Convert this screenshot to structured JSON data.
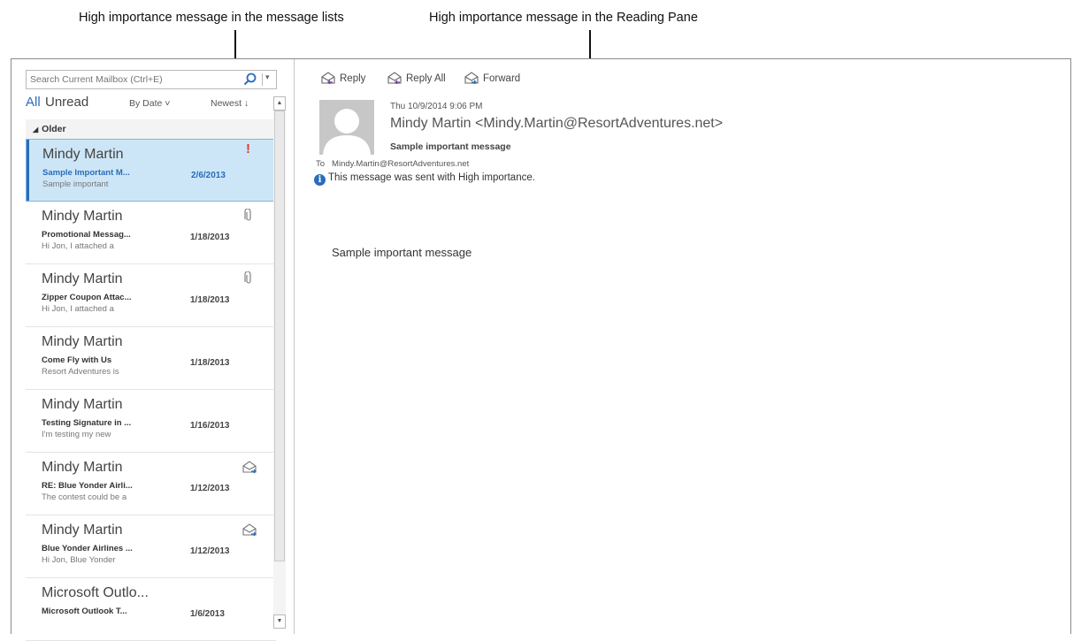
{
  "callouts": {
    "left": "High importance message in the message lists",
    "right": "High importance message in the Reading Pane"
  },
  "search": {
    "placeholder": "Search Current Mailbox (Ctrl+E)"
  },
  "filters": {
    "all": "All",
    "unread": "Unread",
    "sort": "By Date ˅",
    "order": "Newest ↓"
  },
  "group": {
    "label": "Older"
  },
  "messages": [
    {
      "sender": "Mindy Martin",
      "subject": "Sample Important M...",
      "preview": "Sample important",
      "date": "2/6/2013",
      "flag": "!",
      "selected": true
    },
    {
      "sender": "Mindy Martin",
      "subject": "Promotional Messag...",
      "preview": "Hi Jon,  I attached a",
      "date": "1/18/2013",
      "icon": "paperclip-icon"
    },
    {
      "sender": "Mindy Martin",
      "subject": "Zipper Coupon Attac...",
      "preview": "Hi Jon,  I attached a",
      "date": "1/18/2013",
      "icon": "paperclip-icon"
    },
    {
      "sender": "Mindy Martin",
      "subject": "Come Fly with Us",
      "preview": "Resort Adventures is",
      "date": "1/18/2013"
    },
    {
      "sender": "Mindy Martin",
      "subject": "Testing Signature in ...",
      "preview": "I'm testing my new",
      "date": "1/16/2013"
    },
    {
      "sender": "Mindy Martin",
      "subject": "RE: Blue Yonder Airli...",
      "preview": "The contest could be a",
      "date": "1/12/2013",
      "icon": "replied-envelope-icon"
    },
    {
      "sender": "Mindy Martin",
      "subject": "Blue Yonder Airlines ...",
      "preview": "Hi Jon,  Blue Yonder",
      "date": "1/12/2013",
      "icon": "replied-envelope-icon"
    },
    {
      "sender": "Microsoft Outlo...",
      "subject": "Microsoft Outlook T...",
      "preview": "",
      "date": "1/6/2013"
    }
  ],
  "reading": {
    "actions": {
      "reply": "Reply",
      "reply_all": "Reply All",
      "forward": "Forward"
    },
    "sent": "Thu 10/9/2014 9:06 PM",
    "from": "Mindy Martin <Mindy.Martin@ResortAdventures.net>",
    "subject": "Sample important message",
    "to_label": "To",
    "to": "Mindy.Martin@ResortAdventures.net",
    "info": "This message was sent with High importance.",
    "body": "Sample important message"
  },
  "colors": {
    "accent": "#2b6cb9",
    "selected_bg": "#cde6f7",
    "importance": "#e03a2b"
  }
}
